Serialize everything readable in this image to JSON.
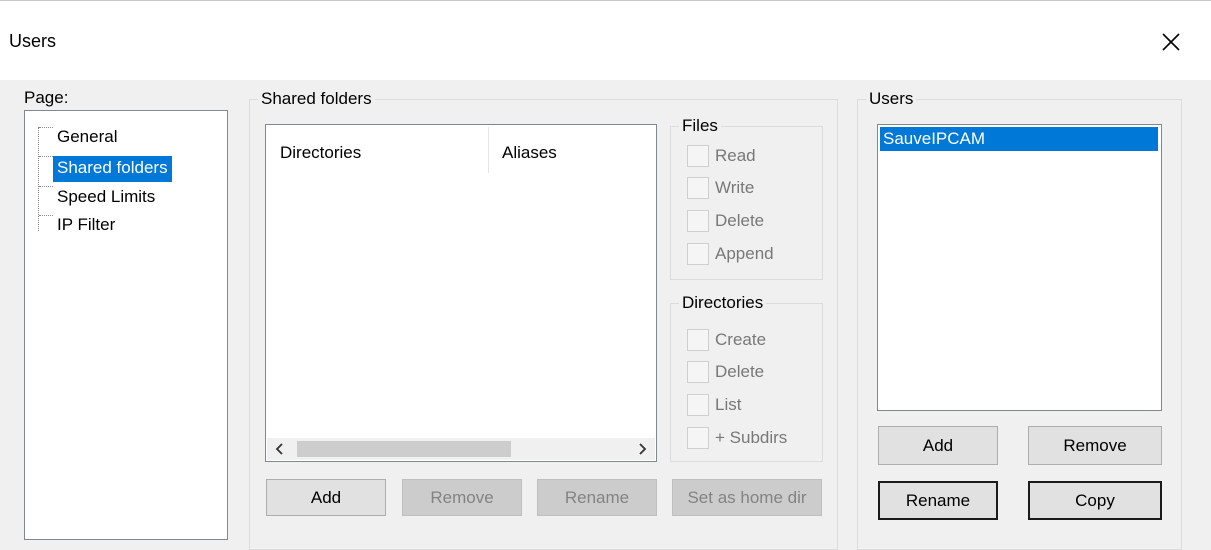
{
  "window": {
    "title": "Users",
    "close_icon": "close-icon"
  },
  "page_section": {
    "label": "Page:",
    "items": [
      {
        "label": "General",
        "selected": false
      },
      {
        "label": "Shared folders",
        "selected": true
      },
      {
        "label": "Speed Limits",
        "selected": false
      },
      {
        "label": "IP Filter",
        "selected": false
      }
    ]
  },
  "shared_folders": {
    "title": "Shared folders",
    "columns": [
      "Directories",
      "Aliases"
    ],
    "rows": [],
    "scroll": {
      "left_icon": "chevron-left-icon",
      "right_icon": "chevron-right-icon"
    },
    "buttons": {
      "add": {
        "label": "Add",
        "enabled": true
      },
      "remove": {
        "label": "Remove",
        "enabled": false
      },
      "rename": {
        "label": "Rename",
        "enabled": false
      },
      "set_home": {
        "label": "Set as home dir",
        "enabled": false
      }
    }
  },
  "files": {
    "title": "Files",
    "options": [
      {
        "label": "Read",
        "checked": false,
        "enabled": false
      },
      {
        "label": "Write",
        "checked": false,
        "enabled": false
      },
      {
        "label": "Delete",
        "checked": false,
        "enabled": false
      },
      {
        "label": "Append",
        "checked": false,
        "enabled": false
      }
    ]
  },
  "directories": {
    "title": "Directories",
    "options": [
      {
        "label": "Create",
        "checked": false,
        "enabled": false
      },
      {
        "label": "Delete",
        "checked": false,
        "enabled": false
      },
      {
        "label": "List",
        "checked": false,
        "enabled": false
      },
      {
        "label": "+ Subdirs",
        "checked": false,
        "enabled": false
      }
    ]
  },
  "users": {
    "title": "Users",
    "items": [
      {
        "label": "SauveIPCAM",
        "selected": true
      }
    ],
    "buttons": {
      "add": {
        "label": "Add"
      },
      "remove": {
        "label": "Remove"
      },
      "rename": {
        "label": "Rename"
      },
      "copy": {
        "label": "Copy"
      }
    }
  },
  "colors": {
    "selection": "#0078d7",
    "window_bg": "#f0f0f0",
    "disabled_text": "#838383"
  }
}
